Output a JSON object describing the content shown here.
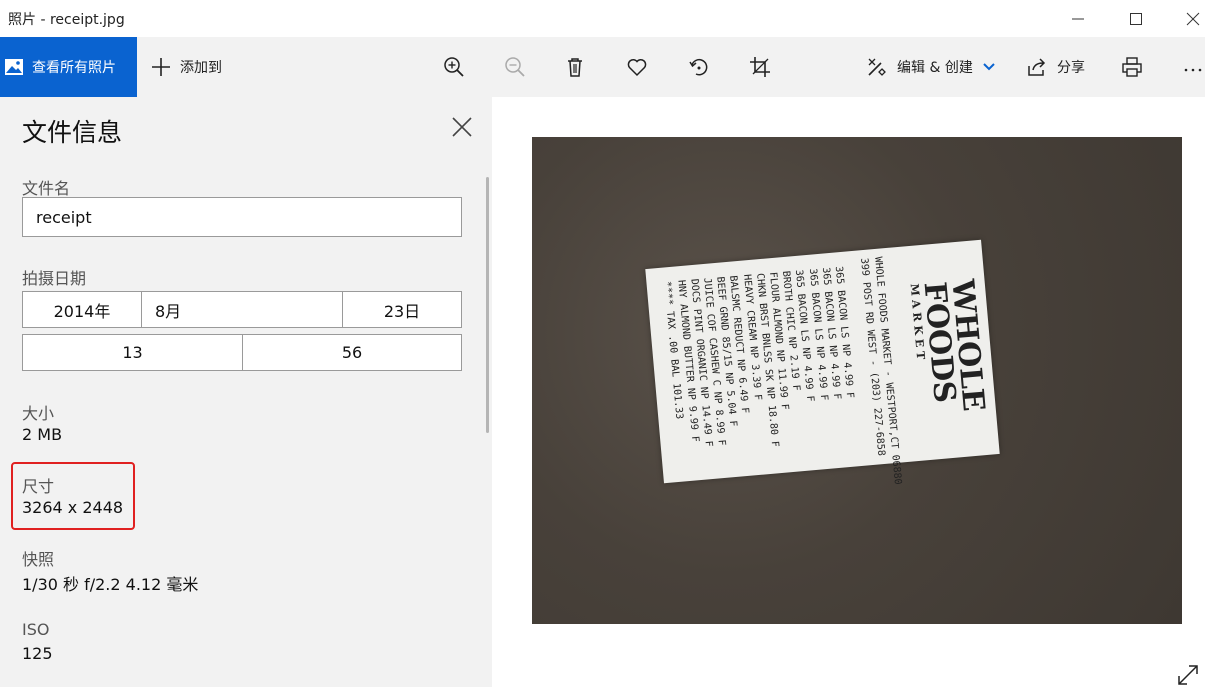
{
  "window": {
    "title": "照片 - receipt.jpg"
  },
  "toolbar": {
    "view_all": "查看所有照片",
    "add_to": "添加到",
    "edit_create": "编辑 & 创建",
    "share": "分享"
  },
  "panel": {
    "heading": "文件信息",
    "filename_label": "文件名",
    "filename_value": "receipt",
    "date_label": "拍摄日期",
    "date_year": "2014年",
    "date_month": "8月",
    "date_day": "23日",
    "time_hour": "13",
    "time_minute": "56",
    "size_label": "大小",
    "size_value": "2 MB",
    "dimensions_label": "尺寸",
    "dimensions_value": "3264 x 2448",
    "snapshot_label": "快照",
    "snapshot_value": "1/30 秒 f/2.2 4.12 毫米",
    "iso_label": "ISO",
    "iso_value": "125"
  },
  "receipt": {
    "logo_line1": "WHOLE",
    "logo_line2": "FOODS",
    "logo_line3": "MARKET",
    "store_line": "WHOLE FOODS MARKET - WESTPORT,CT 06880",
    "address_line": "399 POST RD WEST - (203) 227-6858",
    "items": [
      "365   BACON LS NP   4.99 F",
      "365   BACON LS NP   4.99 F",
      "365   BACON LS NP   4.99 F",
      "365   BACON LS NP   4.99 F",
      "      BROTH CHIC NP  2.19 F",
      "      FLOUR ALMOND NP 11.99 F",
      "CHKN BRST BNLSS SK NP 18.80 F",
      "      HEAVY CREAM NP  3.39 F",
      "      BALSMC REDUCT NP 6.49 F",
      "      BEEF GRND 85/15 NP 5.04 F",
      "      JUICE COF CASHEW C NP 8.99 F",
      "      DOCS PINT ORGANIC NP 14.49 F",
      "      HNY ALMOND BUTTER NP 9.99 F",
      "****  TAX  .00  BAL  101.33"
    ]
  },
  "colors": {
    "accent": "#0a63d0",
    "panel_bg": "#f2f2f2",
    "highlight": "#e02020"
  }
}
